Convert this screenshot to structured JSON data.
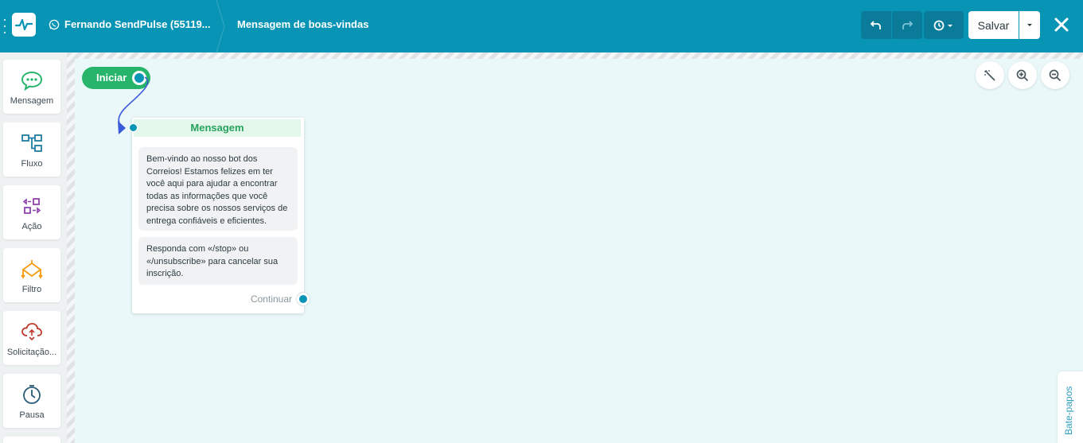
{
  "header": {
    "bot_name": "Fernando SendPulse (55119...",
    "flow_title": "Mensagem de boas-vindas",
    "save_label": "Salvar"
  },
  "sidebar": {
    "items": [
      {
        "label": "Mensagem",
        "icon": "chat-bubble-icon",
        "color": "#27b56c"
      },
      {
        "label": "Fluxo",
        "icon": "flow-icon",
        "color": "#1f7ea1"
      },
      {
        "label": "Ação",
        "icon": "action-icon",
        "color": "#8e44ad"
      },
      {
        "label": "Filtro",
        "icon": "filter-icon",
        "color": "#f39c12"
      },
      {
        "label": "Solicitação...",
        "icon": "api-request-icon",
        "color": "#c0392b"
      },
      {
        "label": "Pausa",
        "icon": "timer-icon",
        "color": "#2c5d7a"
      }
    ]
  },
  "canvas": {
    "start_label": "Iniciar",
    "node": {
      "title": "Mensagem",
      "messages": [
        "Bem-vindo ao nosso bot dos Correios! Estamos felizes em ter você aqui para ajudar a encontrar todas as informações que você precisa sobre os nossos serviços de entrega confiáveis e eficientes.",
        "Responda com «/stop» ou «/unsubscribe» para cancelar sua inscrição."
      ],
      "continue_label": "Continuar"
    },
    "chats_tab": "Bate-papos"
  },
  "colors": {
    "header_bg": "#0894b5",
    "accent_green": "#27b56c",
    "port_blue": "#0a94b6"
  }
}
